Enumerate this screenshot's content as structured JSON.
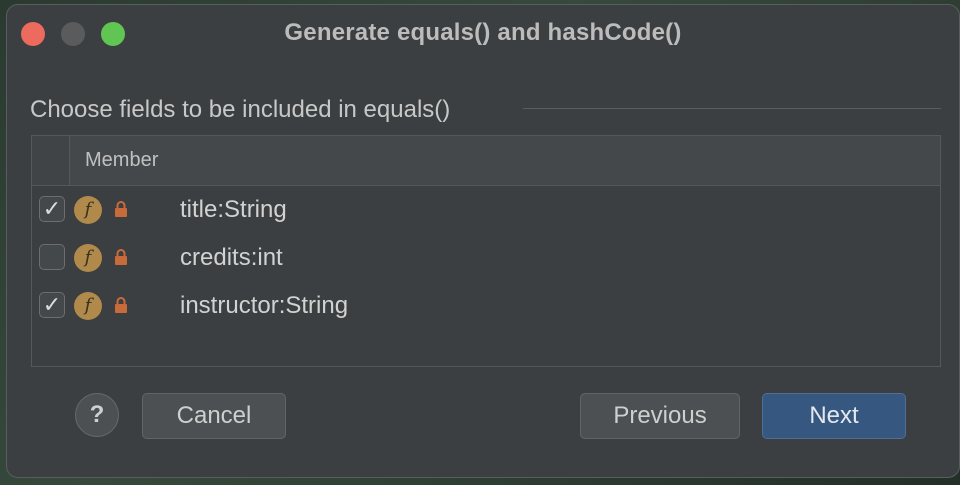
{
  "dialog": {
    "title": "Generate equals() and hashCode()"
  },
  "section": {
    "label": "Choose fields to be included in equals()"
  },
  "table": {
    "column_header": "Member",
    "rows": [
      {
        "name": "title:String",
        "checked": true,
        "icon": "field-icon",
        "modifier_icon": "lock-icon"
      },
      {
        "name": "credits:int",
        "checked": false,
        "icon": "field-icon",
        "modifier_icon": "lock-icon"
      },
      {
        "name": "instructor:String",
        "checked": true,
        "icon": "field-icon",
        "modifier_icon": "lock-icon"
      }
    ],
    "field_icon_letter": "f"
  },
  "buttons": {
    "help": "?",
    "cancel": "Cancel",
    "previous": "Previous",
    "next": "Next"
  },
  "colors": {
    "dialog_bg": "#3c3f41",
    "primary_button": "#365880",
    "field_icon": "#b08a4a",
    "lock": "#c96a3a"
  }
}
